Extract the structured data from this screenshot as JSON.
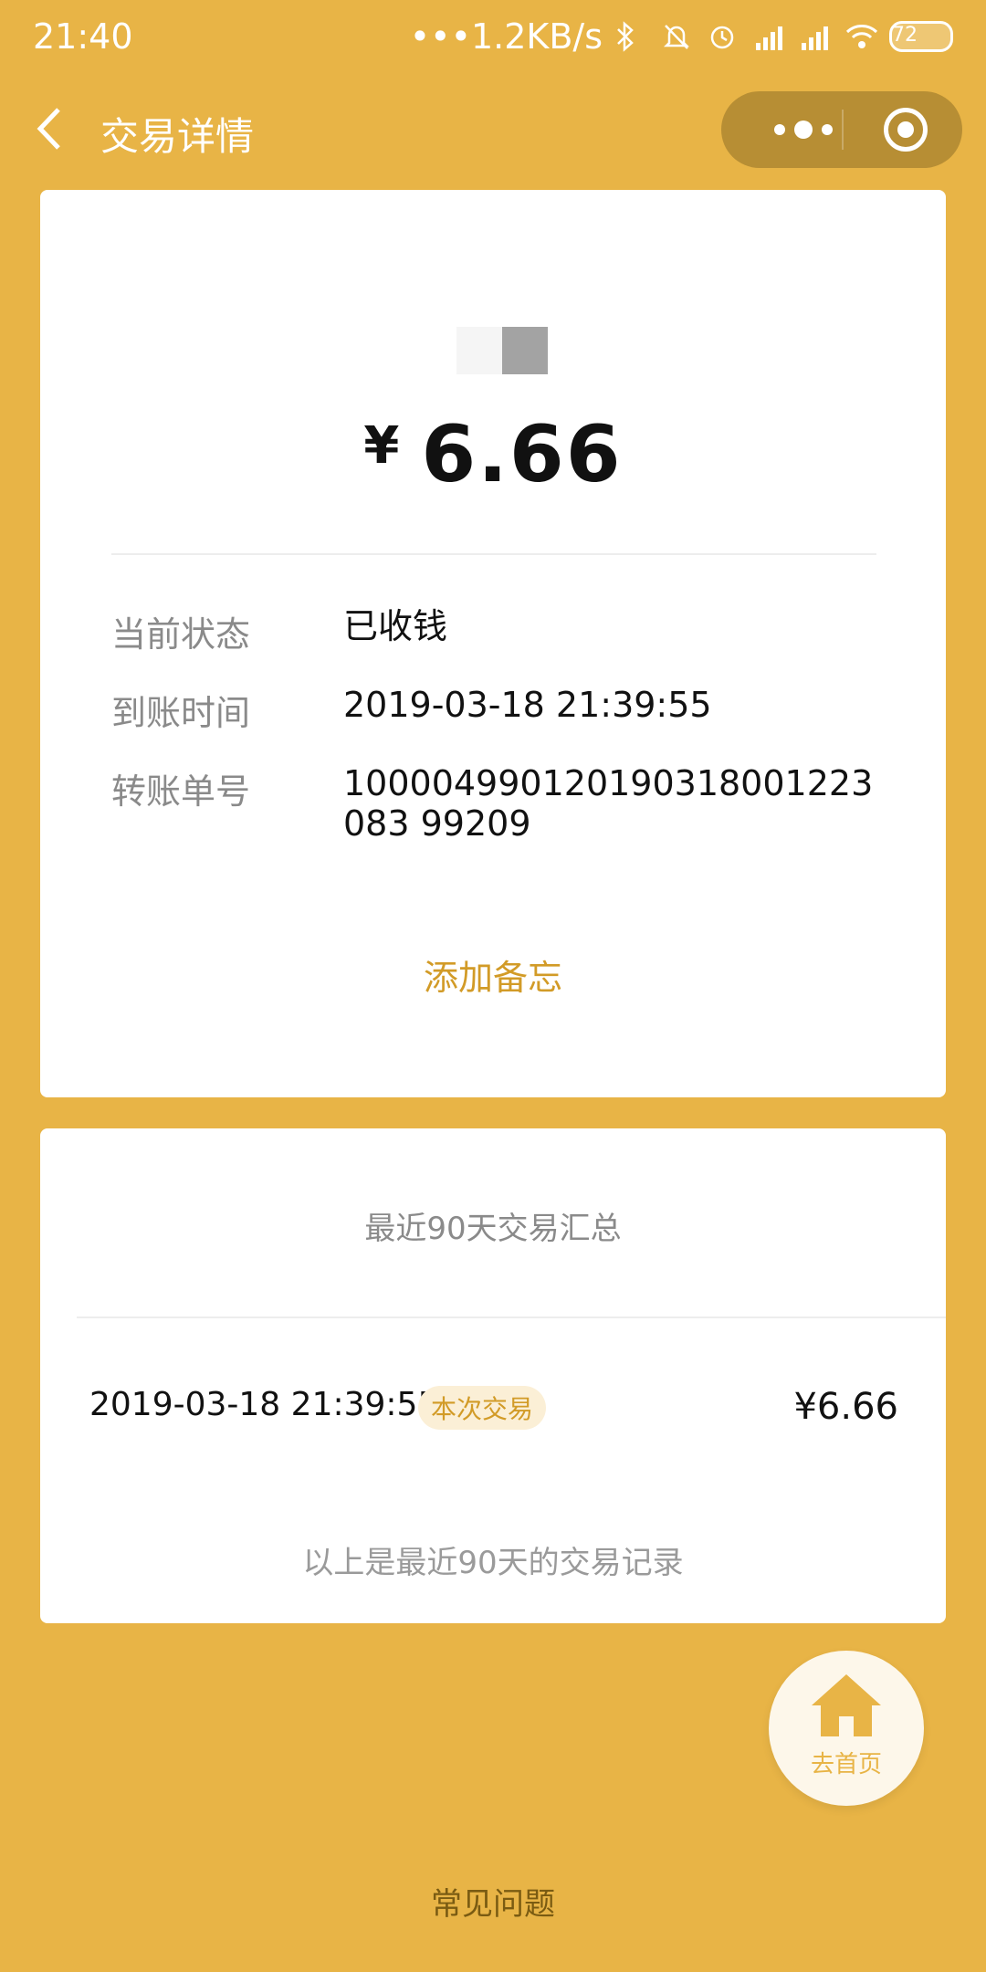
{
  "status_bar": {
    "time": "21:40",
    "network_speed": "•••1.2KB/s",
    "battery": "72",
    "icons": [
      "bluetooth-icon",
      "mute-icon",
      "alarm-icon",
      "signal-hd-icon",
      "signal-hd-icon",
      "wifi-icon",
      "battery-icon"
    ]
  },
  "nav": {
    "title": "交易详情"
  },
  "detail": {
    "amount_symbol": "¥",
    "amount": "6.66",
    "fields": [
      {
        "label": "当前状态",
        "value": "已收钱"
      },
      {
        "label": "到账时间",
        "value": "2019-03-18 21:39:55"
      },
      {
        "label": "转账单号",
        "value": "100004990120190318001223083 99209"
      }
    ],
    "memo_link": "添加备忘"
  },
  "summary": {
    "title": "最近90天交易汇总",
    "transactions": [
      {
        "time": "2019-03-18 21:39:55",
        "badge": "本次交易",
        "amount": "¥6.66"
      }
    ],
    "footer": "以上是最近90天的交易记录"
  },
  "home_button": {
    "label": "去首页"
  },
  "faq": "常见问题",
  "colors": {
    "background": "#E8B446",
    "accent": "#D29B27",
    "capsule": "#B78E34"
  }
}
